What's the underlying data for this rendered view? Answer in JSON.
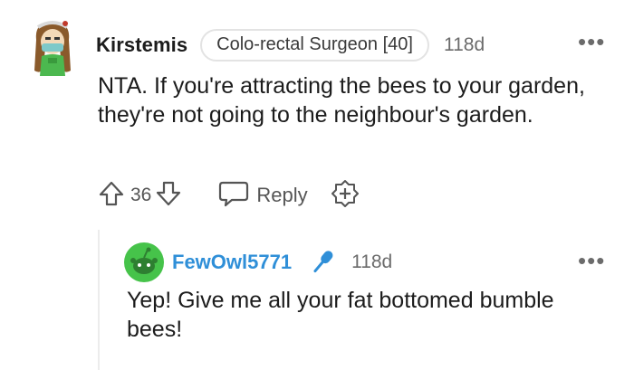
{
  "comment": {
    "username": "Kirstemis",
    "flair": "Colo-rectal Surgeon [40]",
    "time": "118d",
    "more": "•••",
    "body": "NTA. If you're attracting the bees to your garden, they're not going to the neighbour's garden.",
    "votes": "36",
    "reply_label": "Reply",
    "icons": {
      "upvote": "arrow-up-icon",
      "downvote": "arrow-down-icon",
      "reply": "speech-bubble-icon",
      "award": "award-plus-icon",
      "more": "more-dots-icon"
    }
  },
  "reply": {
    "username": "FewOwl5771",
    "time": "118d",
    "more": "•••",
    "body": "Yep! Give me all your fat bottomed bumble bees!",
    "icons": {
      "badge": "microphone-icon",
      "more": "more-dots-icon"
    }
  },
  "colors": {
    "reply_username": "#2f8fd8",
    "mic_badge": "#2f8fd8",
    "avatar_green": "#46c34a",
    "muted_text": "#6b6b6b"
  }
}
